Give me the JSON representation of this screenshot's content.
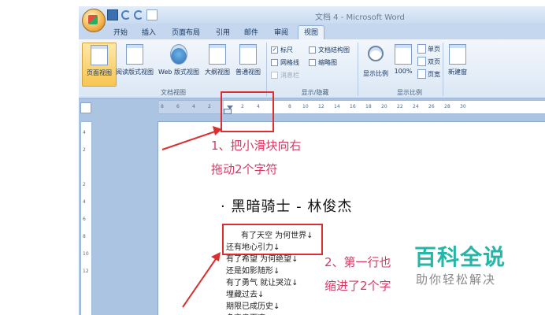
{
  "window": {
    "title": "文档 4 - Microsoft Word"
  },
  "tabs": [
    "开始",
    "插入",
    "页面布局",
    "引用",
    "邮件",
    "审阅",
    "视图"
  ],
  "ribbon": {
    "doc_views": {
      "buttons": [
        "页面视图",
        "阅读版式视图",
        "Web 版式视图",
        "大纲视图",
        "普通视图"
      ],
      "label": "文档视图"
    },
    "show_hide": {
      "items": [
        {
          "label": "标尺",
          "checked": true
        },
        {
          "label": "文档结构图",
          "checked": false
        },
        {
          "label": "网格线",
          "checked": false
        },
        {
          "label": "缩略图",
          "checked": false
        },
        {
          "label": "消息栏",
          "checked": false
        }
      ],
      "label": "显示/隐藏"
    },
    "zoom": {
      "buttons": [
        "显示比例",
        "100%"
      ],
      "small": [
        "单页",
        "双页",
        "页宽"
      ],
      "label": "显示比例"
    },
    "window_group": {
      "button": "新建窗"
    }
  },
  "ruler": {
    "ticks": [
      "8",
      "6",
      "4",
      "2",
      "",
      "2",
      "4",
      "",
      "8",
      "10",
      "12",
      "14",
      "16",
      "18",
      "20",
      "22",
      "24",
      "26",
      "28",
      "30"
    ],
    "vticks": [
      "4",
      "2",
      "",
      "2",
      "4",
      "6",
      "8",
      "10",
      "12"
    ]
  },
  "annotations": {
    "a1_line1": "1、把小滑块向右",
    "a1_line2": "拖动2个字符",
    "a2_line1": "2、第一行也",
    "a2_line2": "缩进了2个字"
  },
  "document": {
    "heading": "· 黑暗骑士 - 林俊杰",
    "lines": [
      "有了天空 为何世界↓",
      "还有地心引力↓",
      "有了希望 为何绝望↓",
      "还是如影随形↓",
      "有了勇气 就让哭泣↓",
      "埋藏过去↓",
      "期限已成历史↓",
      "多宝贵而凄"
    ]
  },
  "watermark": {
    "title": "百科全说",
    "subtitle": "助你轻松解决"
  },
  "colors": {
    "annotation": "#d43a64",
    "box": "#d9302f",
    "watermark": "#27b5a7"
  }
}
